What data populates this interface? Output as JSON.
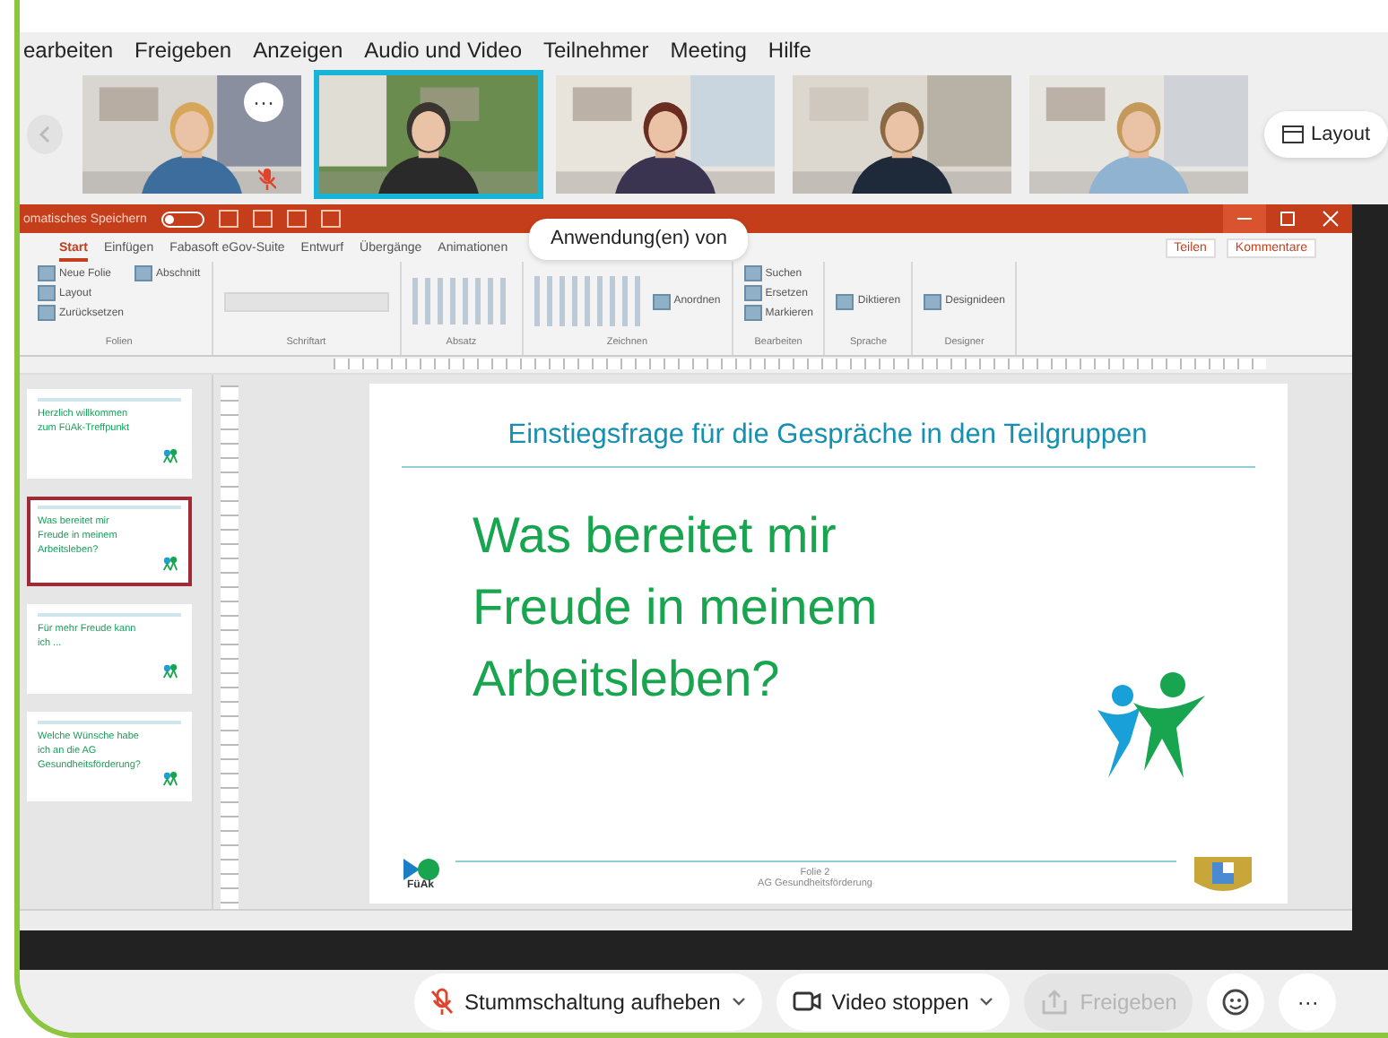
{
  "menu": [
    "earbeiten",
    "Freigeben",
    "Anzeigen",
    "Audio und Video",
    "Teilnehmer",
    "Meeting",
    "Hilfe"
  ],
  "participants": [
    {
      "kind": "picture",
      "selected": false,
      "muted": true,
      "more_button": "···"
    },
    {
      "kind": "picture",
      "selected": true,
      "muted": false
    },
    {
      "kind": "picture",
      "selected": false,
      "muted": false
    },
    {
      "kind": "picture",
      "selected": false,
      "muted": false
    },
    {
      "kind": "picture",
      "selected": false,
      "muted": false
    }
  ],
  "layout_button": "Layout",
  "powerpoint": {
    "autosave_label": "omatisches Speichern",
    "autosave_on": false,
    "ribbon_tabs": [
      {
        "label": "Start",
        "selected": true
      },
      {
        "label": "Einfügen",
        "selected": false
      },
      {
        "label": "Fabasoft eGov-Suite",
        "selected": false
      },
      {
        "label": "Entwurf",
        "selected": false
      },
      {
        "label": "Übergänge",
        "selected": false
      },
      {
        "label": "Animationen",
        "selected": false
      }
    ],
    "share_button": "Teilen",
    "comments_button": "Kommentare",
    "ribbon_groups": [
      {
        "label": "Folien",
        "buttons": [
          "Neue Folie",
          "Layout",
          "Zurücksetzen",
          "Abschnitt"
        ]
      },
      {
        "label": "Schriftart"
      },
      {
        "label": "Absatz"
      },
      {
        "label": "Zeichnen",
        "buttons": [
          "Anordnen"
        ]
      },
      {
        "label": "Bearbeiten",
        "buttons": [
          "Suchen",
          "Ersetzen",
          "Markieren"
        ]
      },
      {
        "label": "Sprache",
        "buttons": [
          "Diktieren"
        ]
      },
      {
        "label": "Designer",
        "buttons": [
          "Designideen"
        ]
      }
    ],
    "thumbnails": [
      {
        "selected": false,
        "lines": [
          "Herzlich willkommen",
          "zum FüAk-Treffpunkt"
        ]
      },
      {
        "selected": true,
        "lines": [
          "Was bereitet mir",
          "Freude in meinem",
          "Arbeitsleben?"
        ]
      },
      {
        "selected": false,
        "lines": [
          "Für mehr Freude kann",
          "ich ..."
        ]
      },
      {
        "selected": false,
        "lines": [
          "Welche Wünsche habe",
          "ich an die AG",
          "Gesundheitsförderung?"
        ]
      }
    ],
    "slide": {
      "title": "Einstiegsfrage für die Gespräche in den Teilgruppen",
      "question": [
        "Was bereitet mir",
        "Freude in meinem",
        "Arbeitsleben?"
      ],
      "logo_text": "FüAk",
      "footer": [
        "Folie 2",
        "AG Gesundheitsförderung"
      ]
    }
  },
  "tooltip": "Anwendung(en) von",
  "controls": [
    {
      "kind": "mute",
      "label": "Stummschaltung aufheben",
      "disabled": false,
      "caret": true
    },
    {
      "kind": "video",
      "label": "Video stoppen",
      "disabled": false,
      "caret": true
    },
    {
      "kind": "share",
      "label": "Freigeben",
      "disabled": true,
      "caret": false
    },
    {
      "kind": "emoji",
      "disabled": false,
      "caret": false
    },
    {
      "kind": "more",
      "label": "···",
      "disabled": false,
      "caret": false
    }
  ]
}
